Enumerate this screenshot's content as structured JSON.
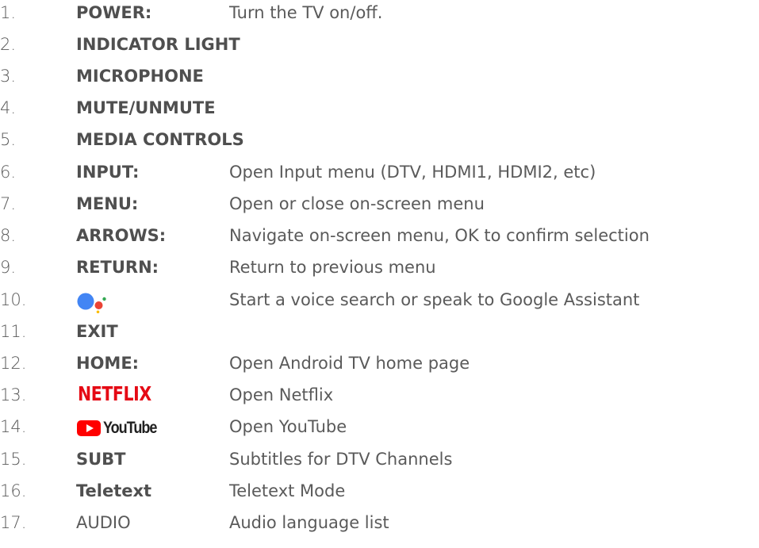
{
  "colors": {
    "text": "#5a5a5a",
    "label": "#4f4f4f",
    "netflix_red": "#e50914",
    "youtube_red": "#ff0000",
    "youtube_text": "#212121",
    "assistant_blue": "#4285f4",
    "assistant_red": "#ea4335",
    "assistant_yellow": "#fbbc05",
    "assistant_green": "#34a853"
  },
  "items": [
    {
      "num": "1.",
      "label": "POWER:",
      "desc": "Turn the TV on/off."
    },
    {
      "num": "2.",
      "label": "INDICATOR LIGHT",
      "desc": ""
    },
    {
      "num": "3.",
      "label": "MICROPHONE",
      "desc": ""
    },
    {
      "num": "4.",
      "label": "MUTE/UNMUTE",
      "desc": ""
    },
    {
      "num": "5.",
      "label": "MEDIA CONTROLS",
      "desc": ""
    },
    {
      "num": "6.",
      "label": "INPUT:",
      "desc": "Open Input menu (DTV, HDMI1, HDMI2, etc)"
    },
    {
      "num": "7.",
      "label": "MENU:",
      "desc": "Open or close on-screen menu"
    },
    {
      "num": "8.",
      "label": "ARROWS:",
      "desc": "Navigate on-screen menu, OK to confirm selection"
    },
    {
      "num": "9.",
      "label": "RETURN:",
      "desc": "Return to previous menu"
    },
    {
      "num": "10.",
      "icon": "google-assistant-icon",
      "desc": "Start a voice search or speak to Google Assistant"
    },
    {
      "num": "11.",
      "label": "EXIT",
      "desc": ""
    },
    {
      "num": "12.",
      "label": "HOME:",
      "desc": "Open Android TV home page"
    },
    {
      "num": "13.",
      "logo_text": "NETFLIX",
      "icon": "netflix-logo",
      "desc": "Open Netflix"
    },
    {
      "num": "14.",
      "logo_text": "YouTube",
      "icon": "youtube-logo",
      "desc": "Open YouTube"
    },
    {
      "num": "15.",
      "label": "SUBT",
      "desc": "Subtitles for DTV Channels"
    },
    {
      "num": "16.",
      "label": "Teletext",
      "desc": "Teletext Mode"
    },
    {
      "num": "17.",
      "label": "AUDIO",
      "label_style": "plain",
      "desc": "Audio language list"
    }
  ]
}
